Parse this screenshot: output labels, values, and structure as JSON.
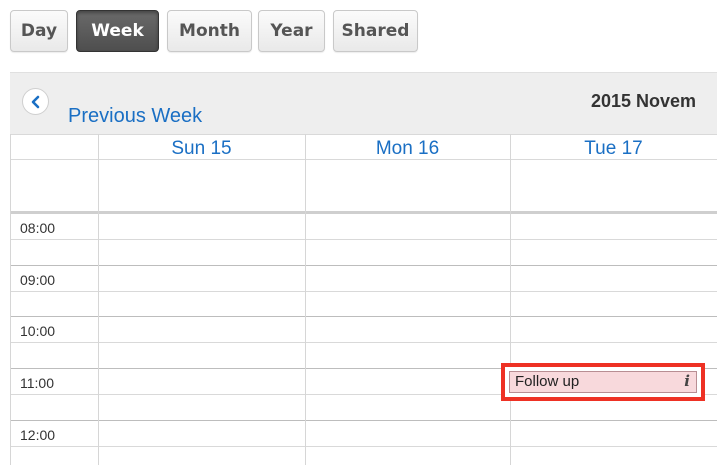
{
  "view_buttons": [
    {
      "label": "Day",
      "active": false
    },
    {
      "label": "Week",
      "active": true
    },
    {
      "label": "Month",
      "active": false
    },
    {
      "label": "Year",
      "active": false
    },
    {
      "label": "Shared",
      "active": false
    }
  ],
  "header": {
    "prev_label": "Previous Week",
    "period_title": "2015 Novem"
  },
  "days": [
    {
      "label": "Sun 15"
    },
    {
      "label": "Mon 16"
    },
    {
      "label": "Tue 17"
    }
  ],
  "times": [
    "08:00",
    "09:00",
    "10:00",
    "11:00",
    "12:00"
  ],
  "event": {
    "title": "Follow up",
    "day": "Tue 17",
    "time": "11:00",
    "highlight_color": "#ee3124",
    "fill_color": "#f8d9dc",
    "icon": "info-icon",
    "icon_glyph": "i"
  },
  "colors": {
    "link": "#1a6fc4",
    "active_button": "#555555"
  }
}
